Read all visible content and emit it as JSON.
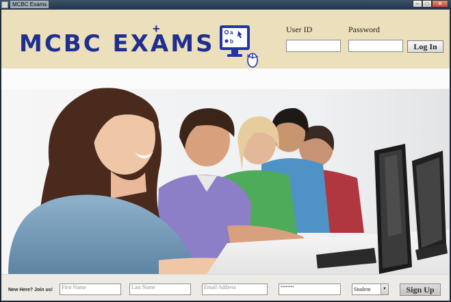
{
  "window": {
    "title": "MCBC Exams",
    "icon": "app-icon"
  },
  "header": {
    "logo_text": "MCBC EXAMS",
    "logo_icon": "monitor-quiz-icon",
    "user_id_label": "User ID",
    "password_label": "Password",
    "user_id_value": "",
    "password_value": "",
    "login_label": "Log In"
  },
  "hero": {
    "description_icon": "students-at-computers-photo"
  },
  "signup": {
    "prompt": "New Here? Join us!",
    "first_name_placeholder": "First Name",
    "last_name_placeholder": "Last Name",
    "email_placeholder": "Email Address",
    "password_mask": "••••••••",
    "role_selected": "Student",
    "signup_label": "Sign Up"
  },
  "colors": {
    "header_bg": "#ebe0bb",
    "logo": "#1f2f8f",
    "footer_bg": "#ecebe6"
  }
}
